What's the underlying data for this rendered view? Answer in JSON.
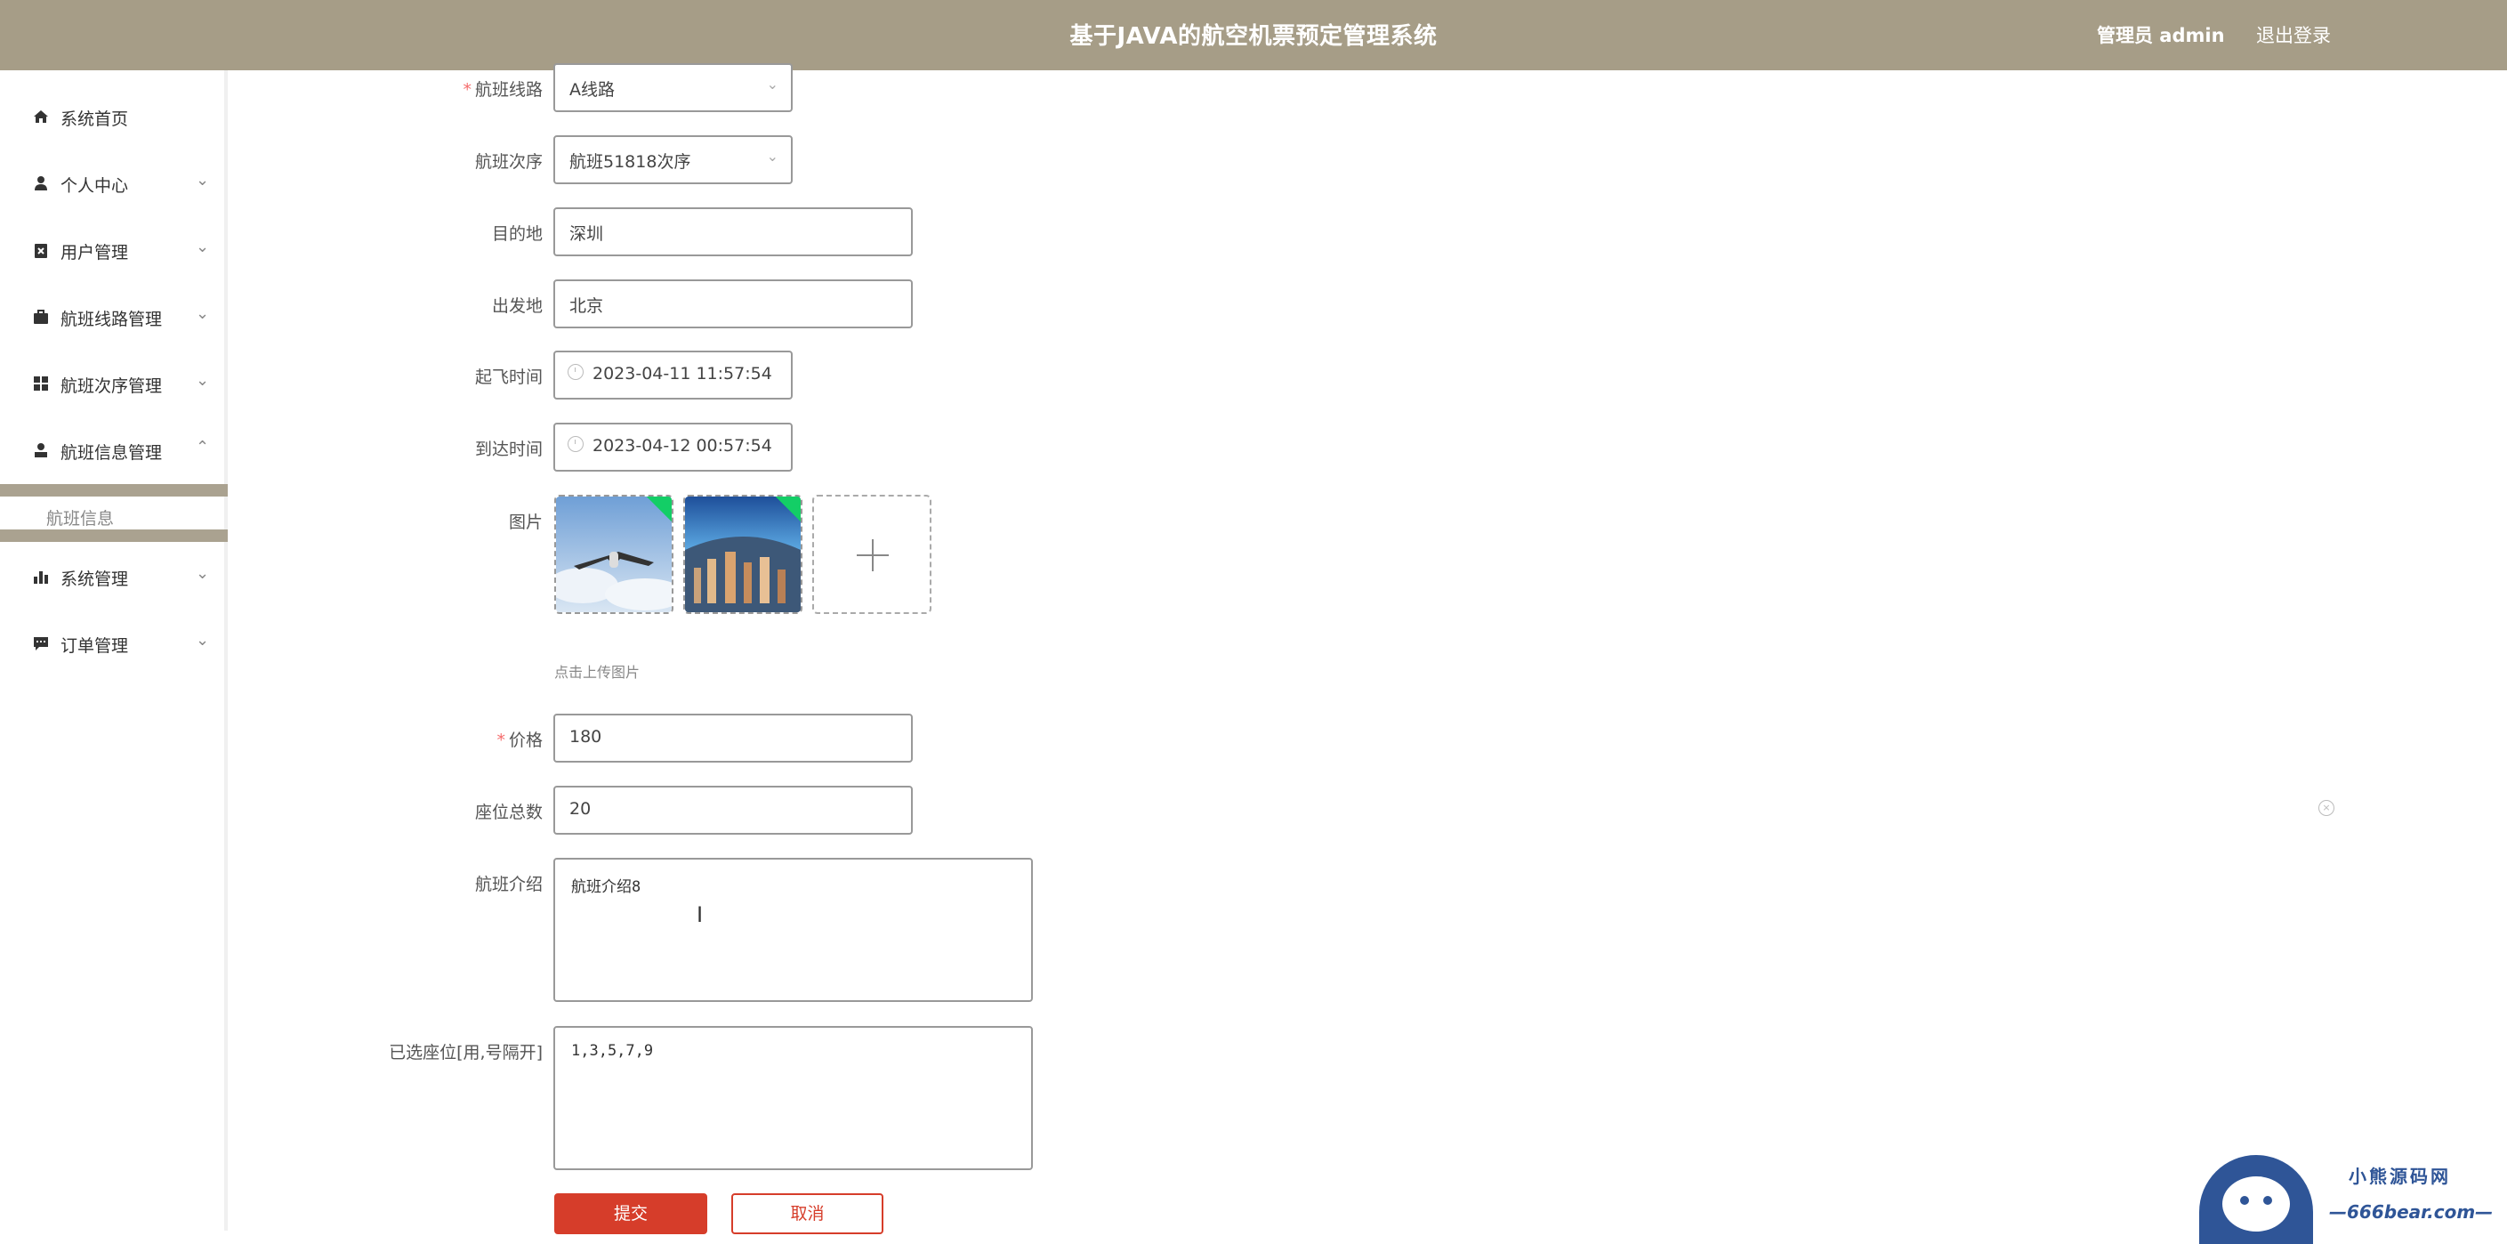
{
  "header": {
    "title": "基于JAVA的航空机票预定管理系统",
    "user": "管理员 admin",
    "logout": "退出登录"
  },
  "sidebar": {
    "items": [
      {
        "label": "系统首页",
        "icon": "home-icon"
      },
      {
        "label": "个人中心",
        "icon": "user-icon"
      },
      {
        "label": "用户管理",
        "icon": "clipboard-x-icon"
      },
      {
        "label": "航班线路管理",
        "icon": "briefcase-icon"
      },
      {
        "label": "航班次序管理",
        "icon": "grid-icon"
      },
      {
        "label": "航班信息管理",
        "icon": "person-icon"
      },
      {
        "label": "系统管理",
        "icon": "bar-chart-icon"
      },
      {
        "label": "订单管理",
        "icon": "chat-icon"
      }
    ],
    "sub_item": "航班信息"
  },
  "form": {
    "route_label": "航班线路",
    "route_value": "A线路",
    "seq_label": "航班次序",
    "seq_value": "航班51818次序",
    "dest_label": "目的地",
    "dest_value": "深圳",
    "origin_label": "出发地",
    "origin_value": "北京",
    "depart_label": "起飞时间",
    "depart_value": "2023-04-11 11:57:54",
    "arrive_label": "到达时间",
    "arrive_value": "2023-04-12 00:57:54",
    "image_label": "图片",
    "upload_hint": "点击上传图片",
    "price_label": "价格",
    "price_value": "180",
    "seats_label": "座位总数",
    "seats_value": "20",
    "intro_label": "航班介绍",
    "intro_value": "航班介绍8",
    "selected_label": "已选座位[用,号隔开]",
    "selected_value": "1,3,5,7,9",
    "submit": "提交",
    "cancel": "取消"
  },
  "watermark": {
    "line1": "小熊源码网",
    "line2": "—666bear.com—"
  },
  "colors": {
    "header_bg": "#a69d87",
    "accent": "#d63d2a",
    "upload_badge": "#13ce66"
  }
}
